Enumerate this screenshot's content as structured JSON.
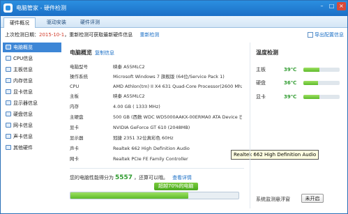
{
  "window": {
    "title": "电脑管家 - 硬件检测",
    "min": "–",
    "max": "□",
    "close": "×"
  },
  "tabs": [
    "硬件概况",
    "驱动安装",
    "硬件评测"
  ],
  "infoline": {
    "prefix": "上次检测日期：",
    "date": "2015-10-1",
    "suffix": "，重新检测可获取最新硬件信息",
    "redetect": "重新检测",
    "export": "导出配置信息"
  },
  "nav": [
    "电脑概览",
    "CPU信息",
    "主板信息",
    "内存信息",
    "显卡信息",
    "显示器信息",
    "硬盘信息",
    "网卡信息",
    "声卡信息",
    "其他硬件"
  ],
  "overview": {
    "title": "电脑概览",
    "copy": "复制信息",
    "rows": [
      {
        "label": "电脑型号",
        "value": "映泰 A55MLC2"
      },
      {
        "label": "操作系统",
        "value": "Microsoft Windows 7 旗舰版 (64位/Service Pack 1)"
      },
      {
        "label": "CPU",
        "value": "AMD Athlon(tm) II X4 631 Quad-Core Processor(2600 Mhz)"
      },
      {
        "label": "主板",
        "value": "映泰 A55MLC2"
      },
      {
        "label": "内存",
        "value": "4.00 GB ( 1333 MHz)"
      },
      {
        "label": "主硬盘",
        "value": "500 GB (西数 WDC WD5000AAKX-00ERMA0 ATA Device 已..."
      },
      {
        "label": "显卡",
        "value": "NVIDIA GeForce GT 610 (2048MB)"
      },
      {
        "label": "显示器",
        "value": "冠捷 2351 32位真彩色 60Hz"
      },
      {
        "label": "声卡",
        "value": "Realtek 662 High Definition Audio"
      },
      {
        "label": "网卡",
        "value": "Realtek PCIe FE Family Controller"
      }
    ],
    "score_prefix": "您的电脑性能得分为",
    "score": "5557",
    "score_suffix": "，还算可以哦。",
    "score_detail": "查看详情",
    "progress_badge": "超越70%的电脑",
    "progress_percent": 70
  },
  "tooltip": "Realtek 662 High Definition Audio",
  "temperature": {
    "title": "温度检测",
    "items": [
      {
        "label": "主板",
        "value": "39℃",
        "level": 0.45
      },
      {
        "label": "硬盘",
        "value": "36℃",
        "level": 0.4
      },
      {
        "label": "显卡",
        "value": "39℃",
        "level": 0.45
      }
    ],
    "monitor_label": "系统监测悬浮窗",
    "monitor_btn": "未开启"
  },
  "colors": {
    "accent": "#1b6fc6",
    "good": "#2e9b2e",
    "date": "#d13a2a"
  }
}
